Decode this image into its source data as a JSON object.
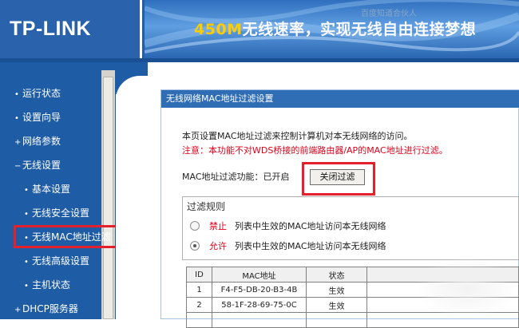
{
  "header": {
    "logo": "TP-LINK",
    "banner_prefix": "450M",
    "banner_rest": "无线速率，实现无线自由连接梦想",
    "watermark": "百度知道合伙人"
  },
  "sidebar": {
    "items": [
      {
        "label": "运行状态",
        "bullet": "•"
      },
      {
        "label": "设置向导",
        "bullet": "•"
      },
      {
        "label": "网络参数",
        "bullet": "+"
      },
      {
        "label": "无线设置",
        "bullet": "−"
      },
      {
        "label": "基本设置",
        "bullet": "•"
      },
      {
        "label": "无线安全设置",
        "bullet": "•"
      },
      {
        "label": "无线MAC地址过滤",
        "bullet": "•"
      },
      {
        "label": "无线高级设置",
        "bullet": "•"
      },
      {
        "label": "主机状态",
        "bullet": "•"
      },
      {
        "label": "DHCP服务器",
        "bullet": "+"
      }
    ]
  },
  "panel": {
    "title": "无线网络MAC地址过滤设置",
    "description": "本页设置MAC地址过滤来控制计算机对本无线网络的访问。",
    "warning": "注意：本功能不对WDS桥接的前端路由器/AP的MAC地址进行过滤。",
    "filter_status_label": "MAC地址过滤功能：已开启",
    "close_filter_button": "关闭过滤",
    "rules": {
      "title": "过滤规则",
      "options": [
        {
          "keyword": "禁止",
          "text": "列表中生效的MAC地址访问本无线网络",
          "checked": false
        },
        {
          "keyword": "允许",
          "text": "列表中生效的MAC地址访问本无线网络",
          "checked": true
        }
      ]
    },
    "table": {
      "headers": [
        "ID",
        "MAC地址",
        "状态",
        ""
      ],
      "rows": [
        {
          "id": "1",
          "mac": "F4-F5-DB-20-B3-4B",
          "status": "生效"
        },
        {
          "id": "2",
          "mac": "58-1F-28-69-75-0C",
          "status": "生效"
        }
      ]
    }
  },
  "colors": {
    "header_blue": "#1f5ea8",
    "panel_title_blue": "#2f6db5",
    "highlight_red": "#e3202b",
    "warning_red": "#e0001a",
    "banner_yellow": "#ffcc00"
  }
}
